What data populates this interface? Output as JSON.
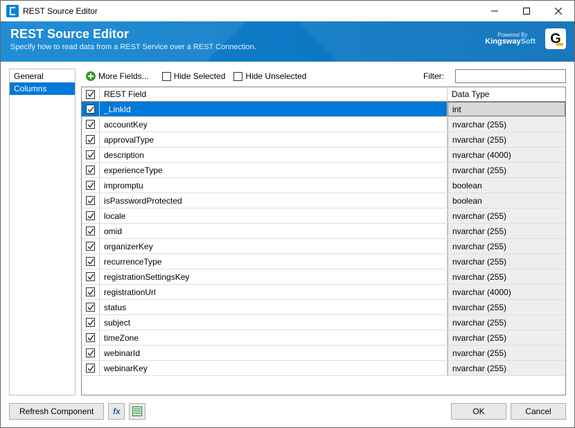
{
  "window": {
    "title": "REST Source Editor"
  },
  "banner": {
    "heading": "REST Source Editor",
    "subheading": "Specify how to read data from a REST Service over a REST Connection.",
    "powered_by": "Powered By",
    "brand_left": "Kingsway",
    "brand_right": "Soft"
  },
  "sidebar": {
    "items": [
      {
        "label": "General",
        "selected": false
      },
      {
        "label": "Columns",
        "selected": true
      }
    ]
  },
  "toolbar": {
    "more_fields": "More Fields...",
    "hide_selected": "Hide Selected",
    "hide_unselected": "Hide Unselected",
    "filter_label": "Filter:",
    "filter_value": ""
  },
  "grid": {
    "header_all_checked": true,
    "col_field": "REST Field",
    "col_type": "Data Type",
    "rows": [
      {
        "checked": true,
        "field": "_LinkId",
        "type": "int",
        "selected": true
      },
      {
        "checked": true,
        "field": "accountKey",
        "type": "nvarchar (255)"
      },
      {
        "checked": true,
        "field": "approvalType",
        "type": "nvarchar (255)"
      },
      {
        "checked": true,
        "field": "description",
        "type": "nvarchar (4000)"
      },
      {
        "checked": true,
        "field": "experienceType",
        "type": "nvarchar (255)"
      },
      {
        "checked": true,
        "field": "impromptu",
        "type": "boolean"
      },
      {
        "checked": true,
        "field": "isPasswordProtected",
        "type": "boolean"
      },
      {
        "checked": true,
        "field": "locale",
        "type": "nvarchar (255)"
      },
      {
        "checked": true,
        "field": "omid",
        "type": "nvarchar (255)"
      },
      {
        "checked": true,
        "field": "organizerKey",
        "type": "nvarchar (255)"
      },
      {
        "checked": true,
        "field": "recurrenceType",
        "type": "nvarchar (255)"
      },
      {
        "checked": true,
        "field": "registrationSettingsKey",
        "type": "nvarchar (255)"
      },
      {
        "checked": true,
        "field": "registrationUrl",
        "type": "nvarchar (4000)"
      },
      {
        "checked": true,
        "field": "status",
        "type": "nvarchar (255)"
      },
      {
        "checked": true,
        "field": "subject",
        "type": "nvarchar (255)"
      },
      {
        "checked": true,
        "field": "timeZone",
        "type": "nvarchar (255)"
      },
      {
        "checked": true,
        "field": "webinarId",
        "type": "nvarchar (255)"
      },
      {
        "checked": true,
        "field": "webinarKey",
        "type": "nvarchar (255)"
      }
    ]
  },
  "footer": {
    "refresh": "Refresh Component",
    "ok": "OK",
    "cancel": "Cancel"
  }
}
